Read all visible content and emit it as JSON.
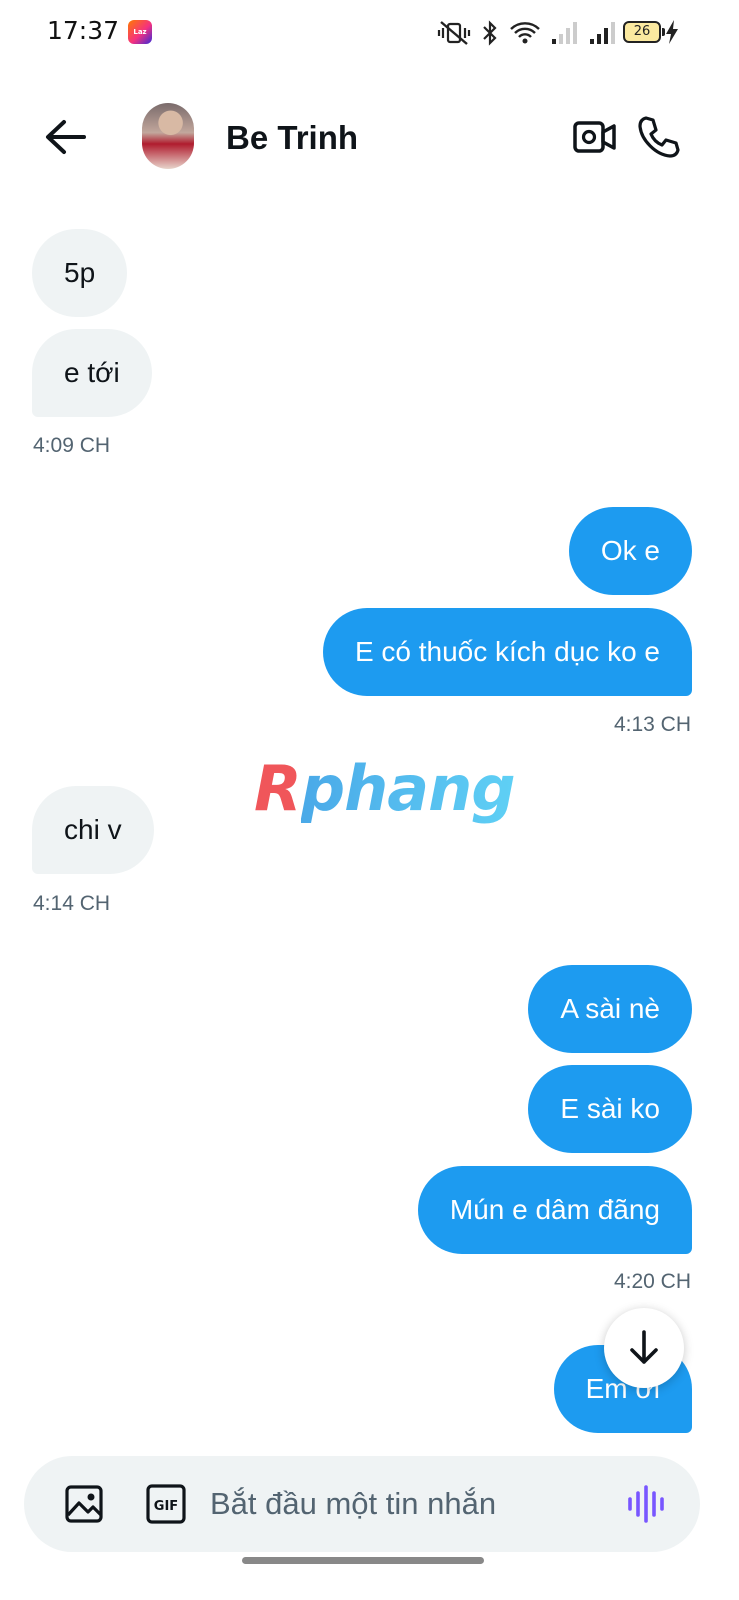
{
  "status_bar": {
    "time": "17:37",
    "app_icon_label": "Laz",
    "battery_level": "26",
    "icons": [
      "mute-vibrate-icon",
      "bluetooth-icon",
      "wifi-icon",
      "signal-icon",
      "signal-icon",
      "battery-icon",
      "charging-icon"
    ]
  },
  "header": {
    "back_icon": "arrow-left-icon",
    "contact_name": "Be Trinh",
    "video_icon": "video-camera-icon",
    "call_icon": "phone-icon"
  },
  "messages": [
    {
      "id": "m1",
      "direction": "in",
      "text": "5p"
    },
    {
      "id": "m2",
      "direction": "in",
      "text": "e tới"
    },
    {
      "id": "t1",
      "timestamp": "4:09 CH"
    },
    {
      "id": "m3",
      "direction": "out",
      "text": "Ok e"
    },
    {
      "id": "m4",
      "direction": "out",
      "text": "E có thuốc kích dục ko e"
    },
    {
      "id": "t2",
      "timestamp": "4:13 CH"
    },
    {
      "id": "m5",
      "direction": "in",
      "text": "chi v"
    },
    {
      "id": "t3",
      "timestamp": "4:14 CH"
    },
    {
      "id": "m6",
      "direction": "out",
      "text": "A sài nè"
    },
    {
      "id": "m7",
      "direction": "out",
      "text": "E sài ko"
    },
    {
      "id": "m8",
      "direction": "out",
      "text": "Mún e dâm đãng"
    },
    {
      "id": "t4",
      "timestamp": "4:20 CH"
    },
    {
      "id": "m9",
      "direction": "out",
      "text": "Em ơi"
    }
  ],
  "watermark": {
    "first": "R",
    "rest": "phang"
  },
  "composer": {
    "placeholder": "Bắt đầu một tin nhắn",
    "value": "",
    "image_icon": "image-icon",
    "gif_label": "GIF",
    "voice_icon": "voice-wave-icon"
  },
  "colors": {
    "outgoing_bubble": "#1d9bf0",
    "incoming_bubble": "#eff3f4",
    "timestamp": "#536471",
    "voice_icon": "#7856ff"
  }
}
